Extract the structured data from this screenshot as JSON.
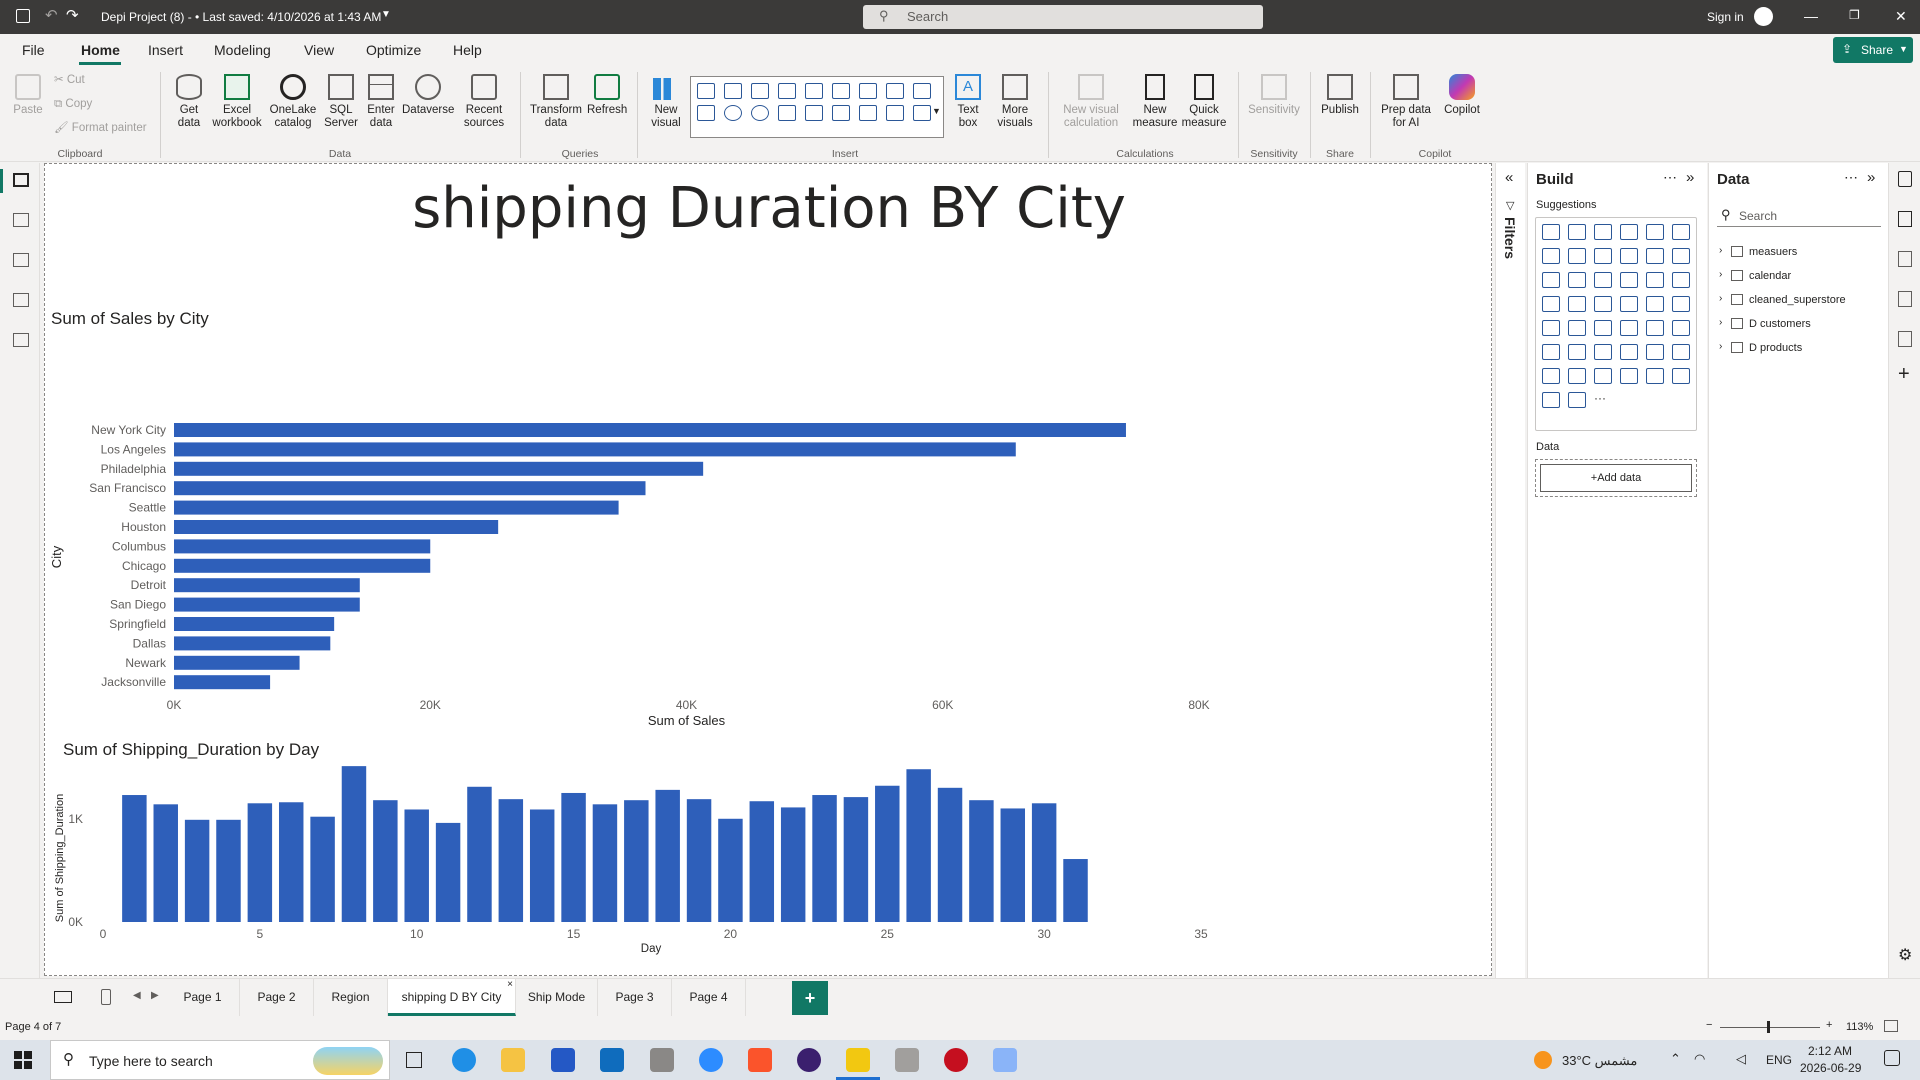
{
  "titlebar": {
    "file_title": "Depi Project (8) - • Last saved: 4/10/2026 at 1:43 AM",
    "search_placeholder": "Search",
    "sign_in": "Sign in"
  },
  "menu": {
    "items": [
      "File",
      "Home",
      "Insert",
      "Modeling",
      "View",
      "Optimize",
      "Help"
    ],
    "active": "Home",
    "share_label": "Share"
  },
  "ribbon": {
    "clipboard": {
      "paste": "Paste",
      "cut": "Cut",
      "copy": "Copy",
      "format_painter": "Format painter",
      "group": "Clipboard"
    },
    "data": {
      "get_data": "Get data",
      "excel": "Excel workbook",
      "onelake": "OneLake catalog",
      "sql": "SQL Server",
      "enter": "Enter data",
      "dataverse": "Dataverse",
      "recent": "Recent sources",
      "group": "Data"
    },
    "queries": {
      "transform": "Transform data",
      "refresh": "Refresh",
      "group": "Queries"
    },
    "insert": {
      "new_visual": "New visual",
      "text_box": "Text box",
      "more_visuals": "More visuals",
      "group": "Insert"
    },
    "calculations": {
      "new_visual_calc": "New visual calculation",
      "new_measure": "New measure",
      "quick_measure": "Quick measure",
      "group": "Calculations"
    },
    "sensitivity": {
      "label": "Sensitivity",
      "group": "Sensitivity"
    },
    "share": {
      "publish": "Publish",
      "group": "Share"
    },
    "copilot": {
      "prep": "Prep data for AI",
      "copilot": "Copilot",
      "group": "Copilot"
    }
  },
  "report": {
    "title": "shipping Duration BY City"
  },
  "chart_data": [
    {
      "type": "bar",
      "orientation": "horizontal",
      "title": "Sum of Sales by City",
      "xlabel": "Sum of Sales",
      "ylabel": "City",
      "categories": [
        "New York City",
        "Los Angeles",
        "Philadelphia",
        "San Francisco",
        "Seattle",
        "Houston",
        "Columbus",
        "Chicago",
        "Detroit",
        "San Diego",
        "Springfield",
        "Dallas",
        "Newark",
        "Jacksonville"
      ],
      "values": [
        74300,
        65700,
        41300,
        36800,
        34700,
        25300,
        20000,
        20000,
        14500,
        14500,
        12500,
        12200,
        9800,
        7500
      ],
      "xlim": [
        0,
        80000
      ],
      "xticks": [
        "0K",
        "20K",
        "40K",
        "60K",
        "80K"
      ],
      "color": "#2e5fba"
    },
    {
      "type": "bar",
      "orientation": "vertical",
      "title": "Sum of Shipping_Duration by Day",
      "xlabel": "Day",
      "ylabel": "Sum of Shipping_Duration",
      "x": [
        1,
        2,
        3,
        4,
        5,
        6,
        7,
        8,
        9,
        10,
        11,
        12,
        13,
        14,
        15,
        16,
        17,
        18,
        19,
        20,
        21,
        22,
        23,
        24,
        25,
        26,
        27,
        28,
        29,
        30,
        31
      ],
      "values": [
        1230,
        1140,
        990,
        990,
        1150,
        1160,
        1020,
        1510,
        1180,
        1090,
        960,
        1310,
        1190,
        1090,
        1250,
        1140,
        1180,
        1280,
        1190,
        1000,
        1170,
        1110,
        1230,
        1210,
        1320,
        1480,
        1300,
        1180,
        1100,
        1150,
        610
      ],
      "ylim": [
        0,
        1550
      ],
      "yticks": [
        "0K",
        "1K"
      ],
      "xticks": [
        "0",
        "5",
        "10",
        "15",
        "20",
        "25",
        "30",
        "35"
      ],
      "color": "#2e5fba"
    }
  ],
  "filters_label": "Filters",
  "build": {
    "title": "Build",
    "suggestions": "Suggestions",
    "data_label": "Data",
    "add_data": "+Add data"
  },
  "datapane": {
    "title": "Data",
    "search_placeholder": "Search",
    "tables": [
      "measuers",
      "calendar",
      "cleaned_superstore",
      "D customers",
      "D products"
    ]
  },
  "tabs": {
    "pages": [
      "Page 1",
      "Page 2",
      "Region",
      "shipping D BY City",
      "Ship Mode",
      "Page 3",
      "Page 4"
    ],
    "active": "shipping D BY City"
  },
  "status": {
    "page": "Page 4 of 7",
    "zoom": "113%"
  },
  "taskbar": {
    "search_placeholder": "Type here to search",
    "weather": "33°C  مشمس",
    "lang": "ENG",
    "time": "2:12 AM",
    "date": "2026-06-29"
  }
}
